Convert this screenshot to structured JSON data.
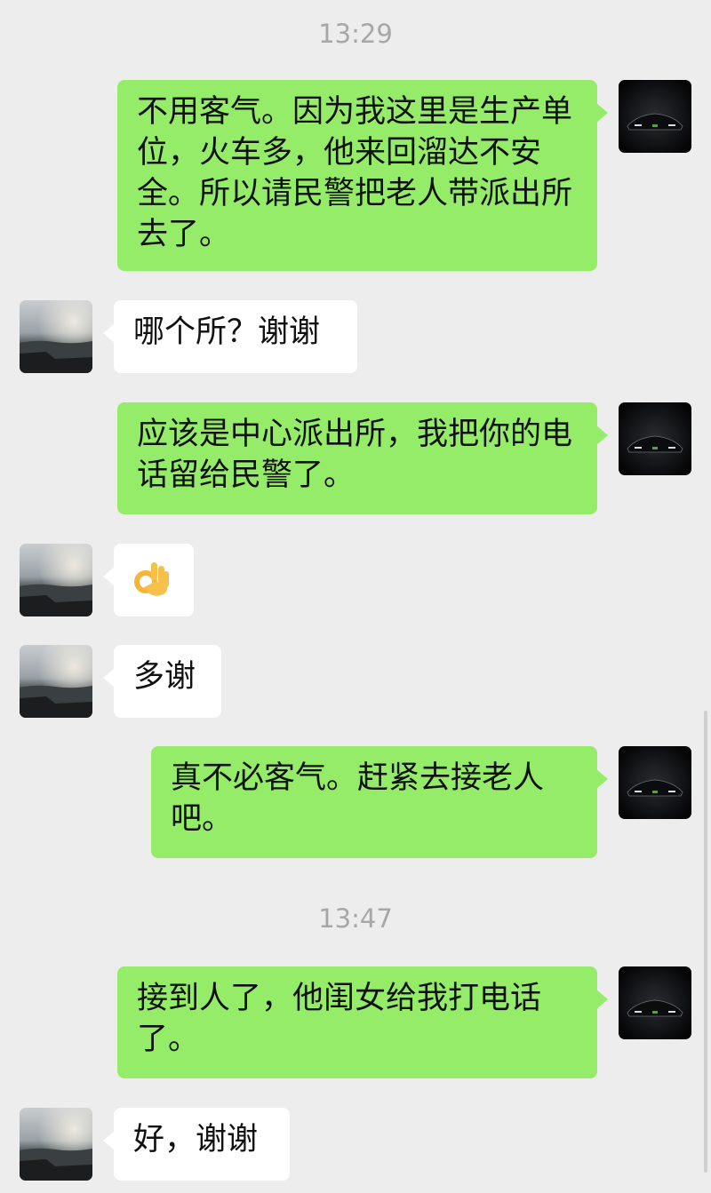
{
  "chat": {
    "timestamps": [
      "13:29",
      "13:47"
    ],
    "messages": [
      {
        "sender": "me",
        "avatar": "car-avatar",
        "text": "不用客气。因为我这里是生产单位，火车多，他来回溜达不安全。所以请民警把老人带派出所去了。"
      },
      {
        "sender": "other",
        "avatar": "lake-avatar",
        "text": "哪个所？谢谢"
      },
      {
        "sender": "me",
        "avatar": "car-avatar",
        "text": "应该是中心派出所，我把你的电话留给民警了。"
      },
      {
        "sender": "other",
        "avatar": "lake-avatar",
        "emoji": "ok-hand-emoji"
      },
      {
        "sender": "other",
        "avatar": "lake-avatar",
        "text": "多谢"
      },
      {
        "sender": "me",
        "avatar": "car-avatar",
        "text": "真不必客气。赶紧去接老人吧。"
      },
      {
        "sender": "me",
        "avatar": "car-avatar",
        "text": "接到人了，他闺女给我打电话了。"
      },
      {
        "sender": "other",
        "avatar": "lake-avatar",
        "text": "好，谢谢"
      }
    ]
  },
  "colors": {
    "background": "#ededed",
    "outgoing_bubble": "#95ec69",
    "incoming_bubble": "#ffffff",
    "timestamp_text": "#a7a7a7"
  }
}
